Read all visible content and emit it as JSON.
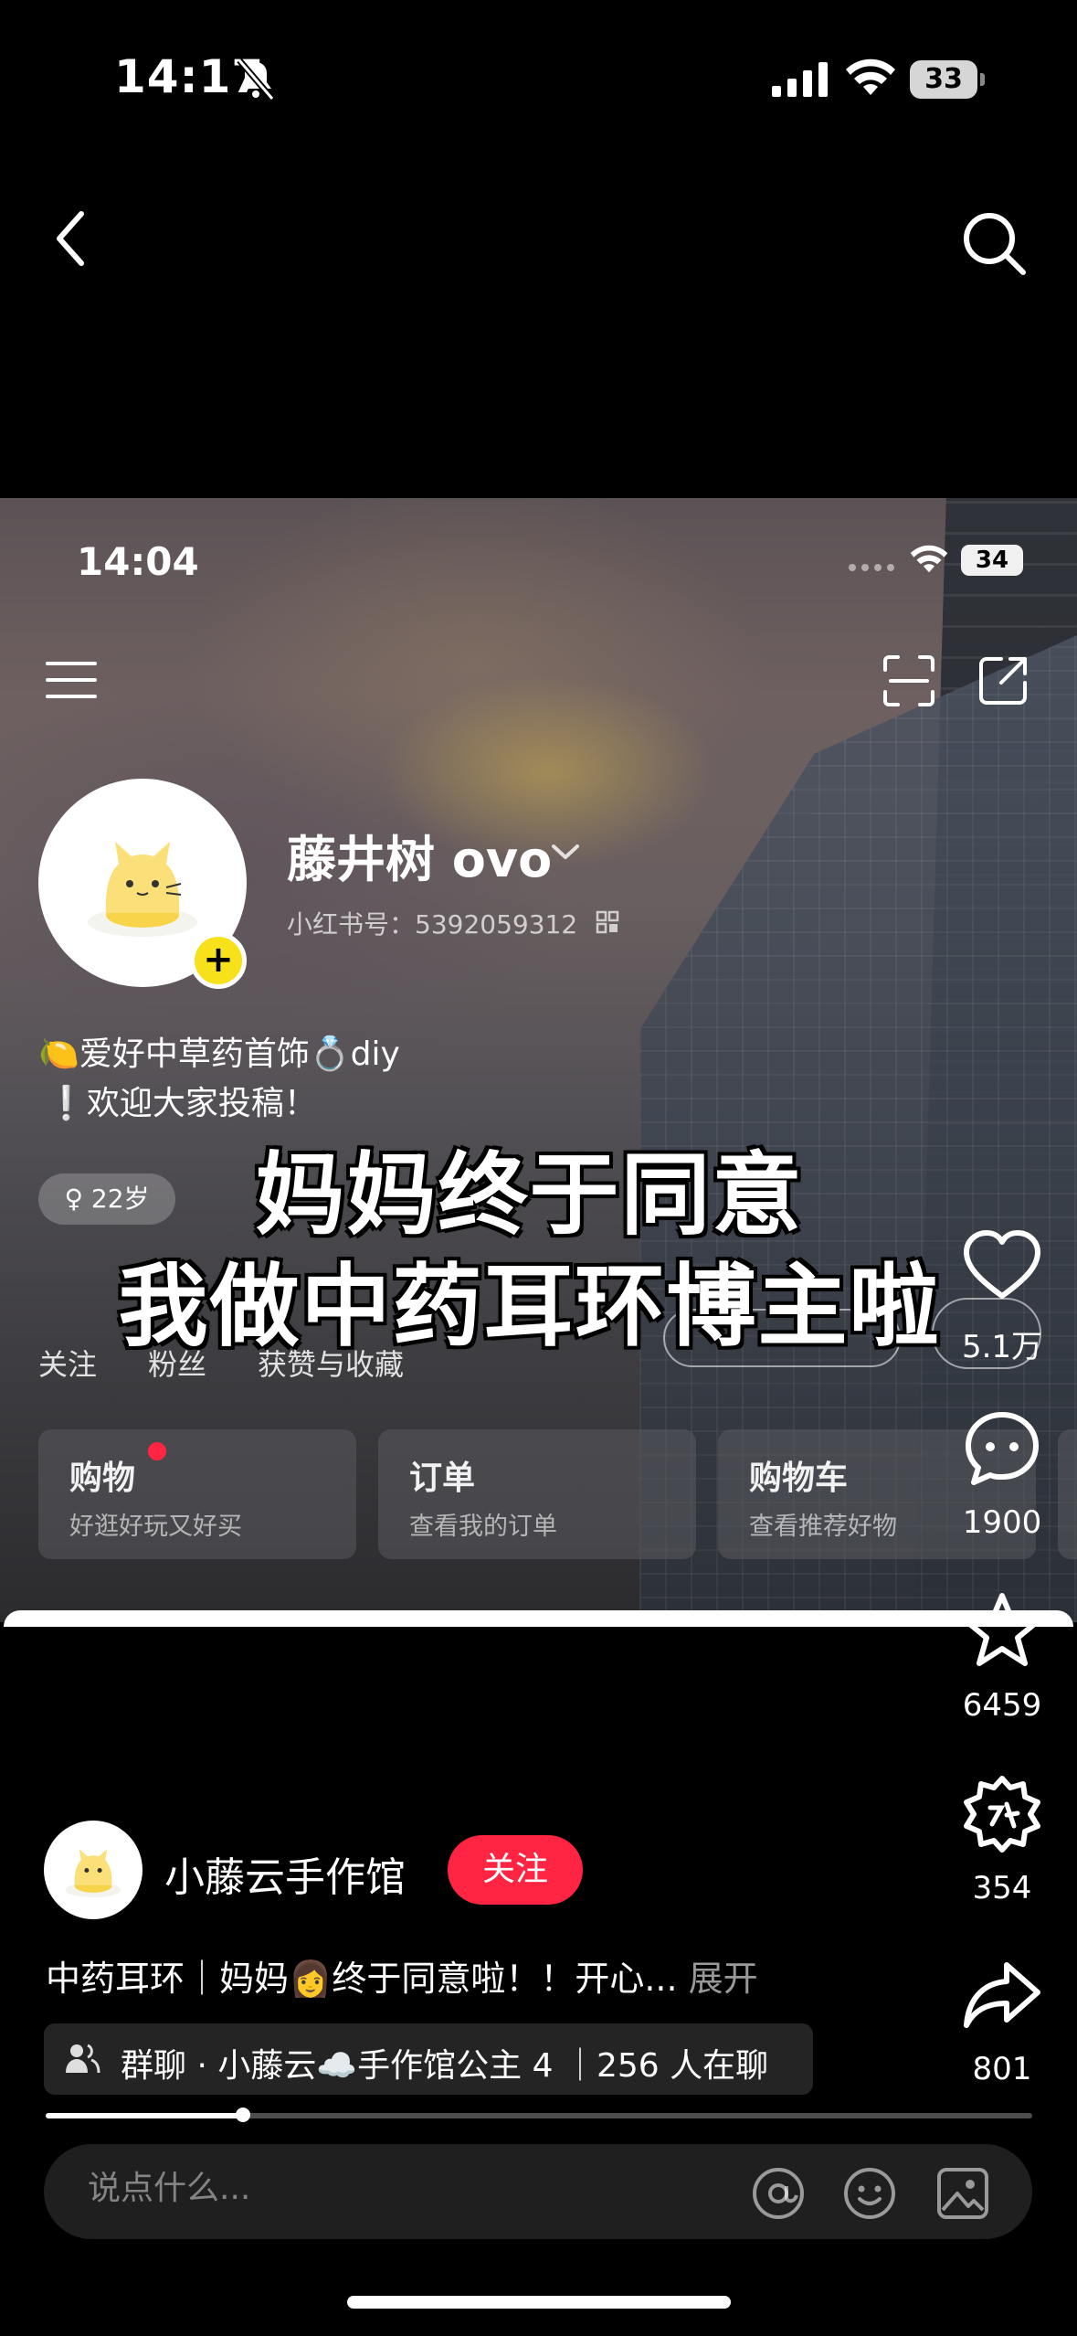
{
  "status_bar": {
    "time": "14:17",
    "battery": "33"
  },
  "video": {
    "inner_status": {
      "time": "14:04",
      "battery": "34"
    },
    "profile": {
      "name": "藤井树 ovo",
      "id_text": "小红书号：5392059312",
      "bio_line1": "🍋爱好中草药首饰💍diy",
      "bio_line2": "❕欢迎大家投稿！",
      "age_tag": "♀ 22岁",
      "stats_labels": [
        "关注",
        "粉丝",
        "获赞与收藏"
      ]
    },
    "cards": [
      {
        "title": "购物",
        "subtitle": "好逛好玩又好买"
      },
      {
        "title": "订单",
        "subtitle": "查看我的订单"
      },
      {
        "title": "购物车",
        "subtitle": "查看推荐好物"
      }
    ],
    "caption_line1": "妈妈终于同意",
    "caption_line2": "我做中药耳环博主啦"
  },
  "rail": {
    "likes": "5.1万",
    "comments": "1900",
    "favorites": "6459",
    "gifts": "354",
    "shares": "801"
  },
  "post": {
    "author": "小藤云手作馆",
    "follow_label": "关注",
    "description": "中药耳环｜妈妈👩终于同意啦！！开心...",
    "expand_label": "展开",
    "group_chat": "群聊 · 小藤云☁️手作馆公主 4 ｜256 人在聊",
    "progress": 0.2
  },
  "comment": {
    "placeholder": "说点什么..."
  },
  "colors": {
    "accent": "#ff2442",
    "tag_yellow": "#f7e11a"
  }
}
